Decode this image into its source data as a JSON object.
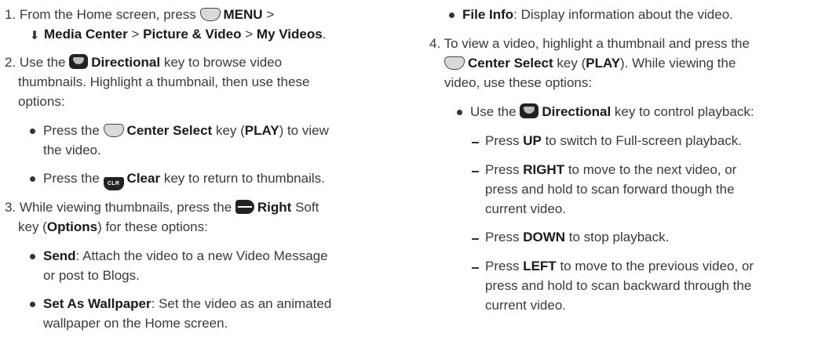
{
  "left": {
    "step1": {
      "num": "1.",
      "t1": "From the Home screen, press",
      "menu": "MENU",
      "gt1": ">",
      "media": "Media Center",
      "gt2": ">",
      "pv": "Picture & Video",
      "gt3": ">",
      "mv": "My Videos",
      "end": "."
    },
    "step2": {
      "num": "2.",
      "pre": "Use the",
      "dir": "Directional",
      "l1": "key to browse video",
      "l2": "thumbnails. Highlight a thumbnail, then use these",
      "l3": "options:"
    },
    "b1": {
      "pre": "Press the",
      "cs": "Center Select",
      "mid": "key (",
      "play": "PLAY",
      "post": ") to view",
      "l2": "the video."
    },
    "b2": {
      "pre": "Press the",
      "clr_icon": "CLR",
      "clr": "Clear",
      "post": "key to return to thumbnails."
    },
    "step3": {
      "num": "3.",
      "pre": "While viewing thumbnails, press the",
      "right": "Right",
      "post": "Soft",
      "l2a": "key (",
      "opt": "Options",
      "l2b": ") for these options:"
    },
    "b3": {
      "send": "Send",
      "t1": ": Attach the video to a new Video Message",
      "l2": "or post to Blogs."
    },
    "b4": {
      "saw": "Set As Wallpaper",
      "t1": ": Set the video as an animated",
      "l2": "wallpaper on the Home screen."
    }
  },
  "right": {
    "b5": {
      "fi": "File Info",
      "t1": ": Display information about the video."
    },
    "step4": {
      "num": "4.",
      "l1": "To view a video, highlight a thumbnail and press the",
      "cs": "Center Select",
      "l2a": "key (",
      "play": "PLAY",
      "l2b": "). While viewing the",
      "l3": "video, use these options:"
    },
    "b6": {
      "pre": "Use the",
      "dir": "Directional",
      "post": "key to control playback:"
    },
    "d1": {
      "pre": "Press",
      "k": "UP",
      "post": "to switch to Full-screen playback."
    },
    "d2": {
      "pre": "Press",
      "k": "RIGHT",
      "post": "to move to the next video, or",
      "l2": "press and hold to scan forward though the",
      "l3": "current video."
    },
    "d3": {
      "pre": "Press",
      "k": "DOWN",
      "post": "to stop playback."
    },
    "d4": {
      "pre": "Press",
      "k": "LEFT",
      "post": "to move to the previous video, or",
      "l2": "press and hold to scan backward through the",
      "l3": "current video."
    }
  }
}
